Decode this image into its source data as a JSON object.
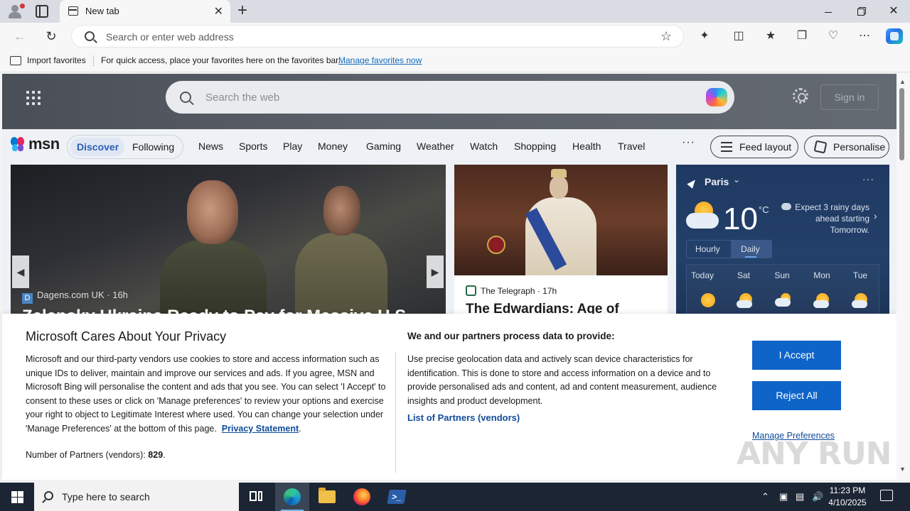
{
  "browser": {
    "tab_title": "New tab",
    "tab_close": "✕",
    "new_tab": "+",
    "window_close": "✕",
    "address_placeholder": "Search or enter web address",
    "favorites_import_label": "Import favorites",
    "favorites_message": "For quick access, place your favorites here on the favorites bar.",
    "favorites_manage_link": "Manage favorites now"
  },
  "msn": {
    "search_placeholder": "Search the web",
    "sign_in": "Sign in",
    "logo_text": "msn",
    "feed_tabs": [
      {
        "label": "Discover",
        "active": true
      },
      {
        "label": "Following",
        "active": false
      }
    ],
    "nav_links": [
      "News",
      "Sports",
      "Play",
      "Money",
      "Gaming",
      "Weather",
      "Watch",
      "Shopping",
      "Health",
      "Travel"
    ],
    "more_label": "···",
    "feed_layout_label": "Feed layout",
    "personalise_label": "Personalise",
    "main_story": {
      "source": "Dagens.com UK",
      "source_initial": "D",
      "age": "16h",
      "headline": "Zelensky Ukraine Ready to Pay for Massive U.S."
    },
    "second_story": {
      "source": "The Telegraph",
      "age": "17h",
      "headline": "The Edwardians: Age of"
    },
    "weather": {
      "city": "Paris",
      "temperature": "10",
      "unit": "°C",
      "description": "Expect 3 rainy days ahead starting Tomorrow.",
      "menu": "···",
      "toggle": {
        "hourly": "Hourly",
        "daily": "Daily",
        "selected": "Daily"
      },
      "days": [
        {
          "label": "Today",
          "icon": "sun-icon"
        },
        {
          "label": "Sat",
          "icon": "partly-cloudy-icon"
        },
        {
          "label": "Sun",
          "icon": "rain-cloud-icon"
        },
        {
          "label": "Mon",
          "icon": "partly-cloudy-icon"
        },
        {
          "label": "Tue",
          "icon": "partly-cloudy-icon"
        }
      ]
    }
  },
  "privacy": {
    "title": "Microsoft Cares About Your Privacy",
    "body": "Microsoft and our third-party vendors use cookies to store and access information such as unique IDs to deliver, maintain and improve our services and ads. If you agree, MSN and Microsoft Bing will personalise the content and ads that you see. You can select 'I Accept' to consent to these uses or click on 'Manage preferences' to review your options and exercise your right to object to Legitimate Interest where used.  You can change your selection under 'Manage Preferences' at the bottom of this page.",
    "privacy_statement_link": "Privacy Statement",
    "partners_label": "Number of Partners (vendors):",
    "partners_count": "829",
    "process_title": "We and our partners process data to provide:",
    "process_body": "Use precise geolocation data and actively scan device characteristics for identification. This is done to store and access information on a device and to provide personalised ads and content, ad and content measurement, audience insights and product development.",
    "vendors_link": "List of Partners (vendors)",
    "accept_label": "I Accept",
    "reject_label": "Reject All",
    "manage_label": "Manage Preferences"
  },
  "watermark": "ANY RUN",
  "taskbar": {
    "search_placeholder": "Type here to search",
    "time": "11:23 PM",
    "date": "4/10/2025"
  },
  "colors": {
    "accent_blue": "#0f64c8",
    "link_blue": "#0f4c9a",
    "weather_bg": "#1f3a62",
    "taskbar_bg": "#1c2533"
  }
}
